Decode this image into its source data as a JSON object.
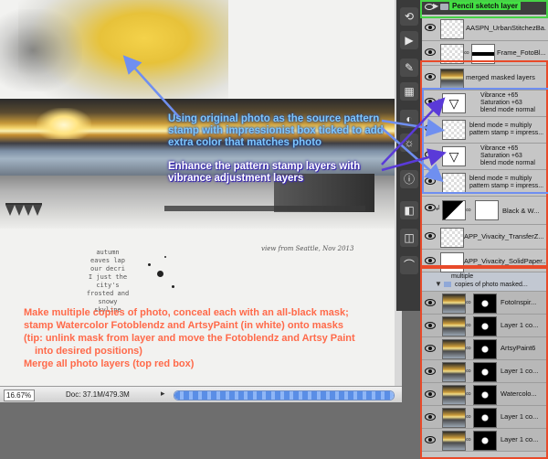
{
  "canvas": {
    "journal_text": "autumn\neaves lap\nour decri\nI just the\ncity's\nfrosted and\nsnowy\nskyline",
    "caption": "view from Seattle, Nov 2013"
  },
  "annotations": {
    "source_note": "Using original photo as the source pattern stamp with impressionist box ticked to add extra color that matches photo",
    "vibrance_note": "Enhance the pattern stamp layers with vibrance adjustment layers",
    "masks_note_1": "Make multiple copies of photo, conceal each with an all-black mask;",
    "masks_note_2": "stamp Watercolor Fotoblendz and ArtsyPaint (in white) onto masks",
    "masks_note_3": "(tip: unlink mask from layer and move the Fotoblendz and Artsy Paint",
    "masks_note_4": "into desired positions)",
    "masks_note_5": "Merge all photo layers (top red box)"
  },
  "status_bar": {
    "zoom": "16.67%",
    "doc_size": "Doc: 37.1M/479.3M",
    "progress": 1.0
  },
  "layers": {
    "top_group": "Pencil sketch layer",
    "rows": [
      {
        "name": "AASPN_UrbanStitchezBa...",
        "thumb": "checker"
      },
      {
        "name": "Frame_FotoBl...",
        "thumb": "checker"
      },
      {
        "name": "merged masked layers",
        "thumb": "photo"
      },
      {
        "name": "Vibrance +65",
        "sub": "Saturation +63",
        "sub2": "blend mode normal",
        "thumb": "vib"
      },
      {
        "name": "blend mode = multiply",
        "sub": "pattern stamp = impress...",
        "thumb": "checker"
      },
      {
        "name": "Vibrance +65",
        "sub": "Saturation +63",
        "sub2": "blend mode normal",
        "thumb": "vib"
      },
      {
        "name": "blend mode = multiply",
        "sub": "pattern stamp = impress...",
        "thumb": "checker"
      },
      {
        "name": "Black & W...",
        "thumb": "adjust"
      },
      {
        "name": "APP_Vivacity_TransferZ...",
        "thumb": "checker"
      },
      {
        "name": "APP_Vivacity_SolidPaper...",
        "thumb": "white"
      }
    ],
    "group_note": "multiple",
    "group_name": "copies of photo masked...",
    "sub_rows": [
      {
        "name": "FotoInspir..."
      },
      {
        "name": "Layer 1 co..."
      },
      {
        "name": "ArtsyPaint6"
      },
      {
        "name": "Layer 1 co..."
      },
      {
        "name": "Watercolo..."
      },
      {
        "name": "Layer 1 co..."
      },
      {
        "name": "Layer 1 co..."
      }
    ]
  },
  "colors": {
    "annotation_blue": "#7ec8ff",
    "annotation_red": "#ff6a4a",
    "box_green": "#46d246",
    "box_red": "#e84a2a",
    "box_blue": "#6f8ff0"
  },
  "icons": [
    "eye-icon",
    "folder-icon",
    "link-icon",
    "chain-icon",
    "brush-icon",
    "info-icon",
    "layers-icon",
    "history-icon"
  ]
}
